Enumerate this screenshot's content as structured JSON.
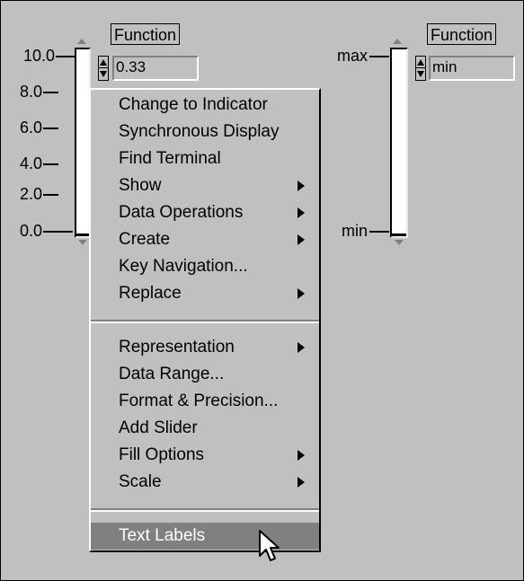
{
  "left_control": {
    "label": "Function",
    "scale": [
      "10.0",
      "8.0",
      "6.0",
      "4.0",
      "2.0",
      "0.0"
    ],
    "value": "0.33"
  },
  "right_control": {
    "label": "Function",
    "scale_top": "max",
    "scale_bottom": "min",
    "value": "min"
  },
  "context_menu": {
    "group1": [
      {
        "label": "Change to Indicator",
        "submenu": false
      },
      {
        "label": "Synchronous Display",
        "submenu": false
      },
      {
        "label": "Find Terminal",
        "submenu": false
      },
      {
        "label": "Show",
        "submenu": true
      },
      {
        "label": "Data Operations",
        "submenu": true
      },
      {
        "label": "Create",
        "submenu": true
      },
      {
        "label": "Key Navigation...",
        "submenu": false
      },
      {
        "label": "Replace",
        "submenu": true
      }
    ],
    "group2": [
      {
        "label": "Representation",
        "submenu": true
      },
      {
        "label": "Data Range...",
        "submenu": false
      },
      {
        "label": "Format & Precision...",
        "submenu": false
      },
      {
        "label": "Add Slider",
        "submenu": false
      },
      {
        "label": "Fill Options",
        "submenu": true
      },
      {
        "label": "Scale",
        "submenu": true
      }
    ],
    "group3": [
      {
        "label": "Text Labels",
        "submenu": false,
        "highlighted": true
      }
    ]
  },
  "colors": {
    "panel_bg": "#c0c0c0",
    "highlight_bg": "#808080",
    "highlight_text": "#ffffff"
  },
  "icons": {
    "cursor": "mouse-pointer-icon"
  }
}
